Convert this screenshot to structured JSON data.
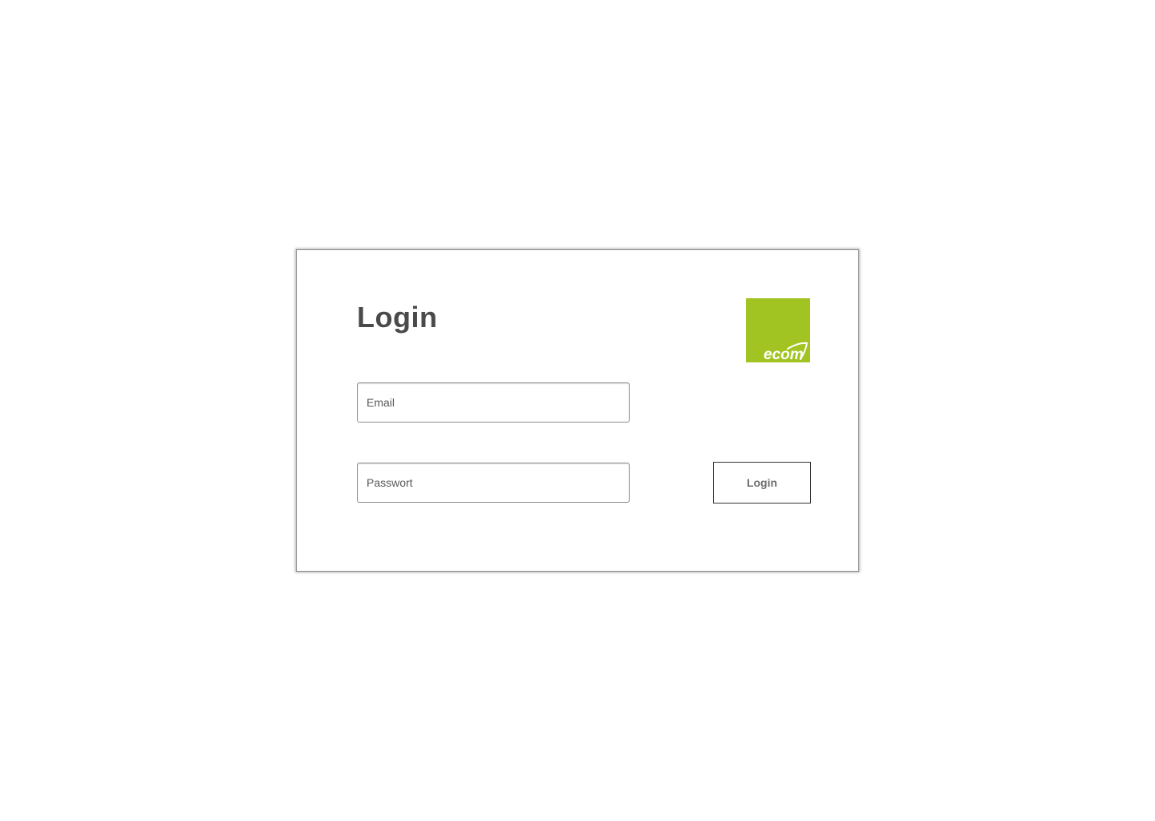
{
  "login_card": {
    "title": "Login",
    "logo": {
      "text": "ecom",
      "icon": "ecom-logo-icon",
      "background_color": "#a2c422",
      "text_color": "#ffffff"
    },
    "email": {
      "placeholder": "Email",
      "value": ""
    },
    "password": {
      "placeholder": "Passwort",
      "value": ""
    },
    "submit_label": "Login"
  },
  "colors": {
    "accent": "#a2c422",
    "title_text": "#4a4a4a",
    "button_text": "#6e6e6e",
    "border": "#8c8c8c"
  }
}
